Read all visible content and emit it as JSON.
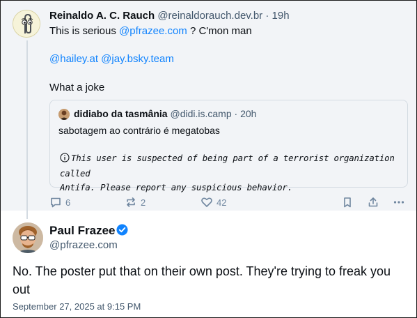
{
  "parent_post": {
    "author_name": "Reinaldo A. C. Rauch",
    "author_handle": "@reinaldorauch.dev.br",
    "separator": "·",
    "time": "19h",
    "line1_text": "This is serious ",
    "line1_mention": "@pfrazee.com",
    "line1_tail": " ? C'mon man",
    "mention_a": "@hailey.at",
    "mention_b": "@jay.bsky.team",
    "line3": "What a joke",
    "quote": {
      "author_name": "didiabo da tasmânia",
      "author_handle": "@didi.is.camp",
      "separator": "·",
      "time": "20h",
      "text": "sabotagem ao contrário é megatobas",
      "warning_line1": "This user is suspected of being part of a terrorist organization called",
      "warning_line2": "Antifa. Please report any suspicious behavior."
    },
    "actions": {
      "replies": "6",
      "reposts": "2",
      "likes": "42"
    }
  },
  "main_post": {
    "author_name": "Paul Frazee",
    "author_handle": "@pfrazee.com",
    "text": "No. The poster put that on their own post. They're trying to freak you out",
    "date": "September 27, 2025 at 9:15 PM"
  },
  "colors": {
    "accent": "#1083fe",
    "muted": "#42576c",
    "icon": "#6f869f",
    "parent_bg": "#f2f4f7",
    "border": "#d4dbe2"
  },
  "icons": [
    "reply-icon",
    "repost-icon",
    "like-icon",
    "bookmark-icon",
    "share-icon",
    "more-icon",
    "info-icon",
    "verified-badge-icon"
  ]
}
